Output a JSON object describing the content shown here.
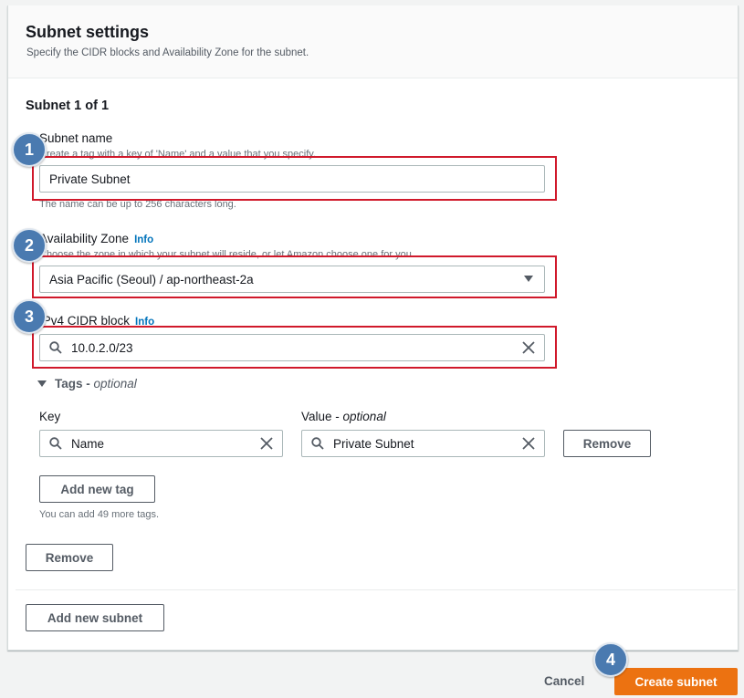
{
  "header": {
    "title": "Subnet settings",
    "subtitle": "Specify the CIDR blocks and Availability Zone for the subnet."
  },
  "subnet": {
    "heading": "Subnet 1 of 1",
    "name": {
      "label": "Subnet name",
      "description": "Create a tag with a key of 'Name' and a value that you specify.",
      "value": "Private Subnet",
      "constraint": "The name can be up to 256 characters long."
    },
    "az": {
      "label": "Availability Zone",
      "info": "Info",
      "description": "Choose the zone in which your subnet will reside, or let Amazon choose one for you.",
      "value": "Asia Pacific (Seoul) / ap-northeast-2a"
    },
    "cidr": {
      "label": "IPv4 CIDR block",
      "info": "Info",
      "value": "10.0.2.0/23"
    },
    "tags": {
      "toggle_label": "Tags",
      "toggle_optional": "optional",
      "key_header": "Key",
      "value_header": "Value",
      "value_optional": "optional",
      "rows": [
        {
          "key": "Name",
          "value": "Private Subnet",
          "remove_label": "Remove"
        }
      ],
      "add_label": "Add new tag",
      "hint": "You can add 49 more tags."
    },
    "remove_label": "Remove"
  },
  "add_subnet_label": "Add new subnet",
  "footer": {
    "cancel_label": "Cancel",
    "create_label": "Create subnet"
  },
  "callouts": [
    "1",
    "2",
    "3",
    "4"
  ],
  "colors": {
    "primary": "#ec7211",
    "link": "#0073bb",
    "highlight": "#d0192b",
    "callout": "#4a7ab0"
  }
}
